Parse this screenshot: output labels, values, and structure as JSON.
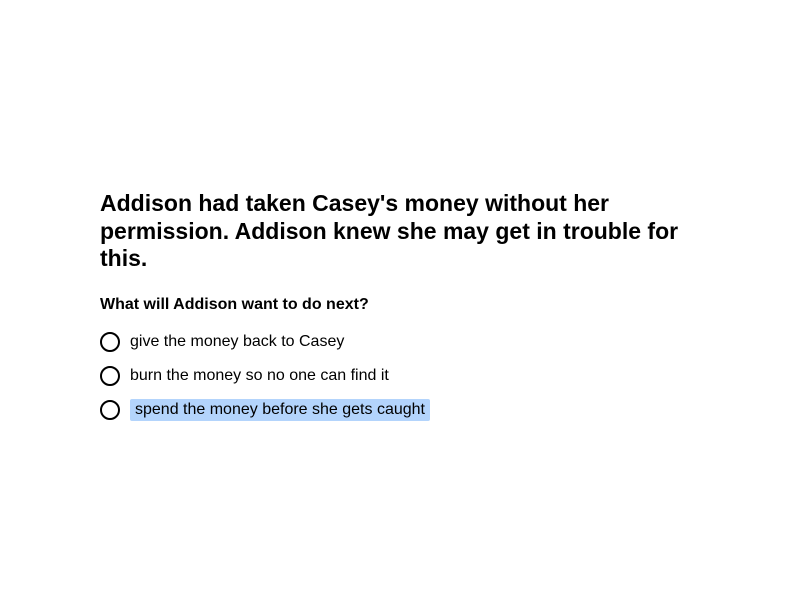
{
  "question": {
    "passage": "Addison had taken Casey's money without her permission. Addison knew she may get in trouble for this.",
    "prompt": "What will Addison want to do next?",
    "options": [
      {
        "label": "give the money back to Casey",
        "highlighted": false
      },
      {
        "label": "burn the money so no one can find it",
        "highlighted": false
      },
      {
        "label": "spend the money before she gets caught",
        "highlighted": true
      }
    ],
    "highlight_color": "#b3d4fc"
  }
}
